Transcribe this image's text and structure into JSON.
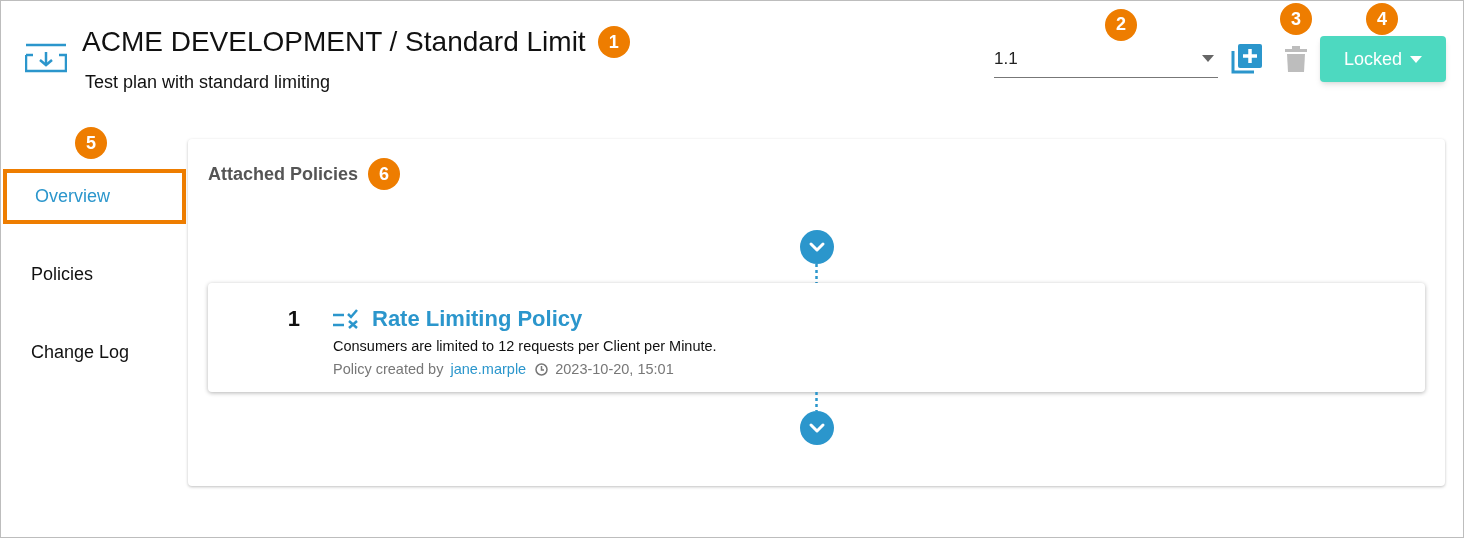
{
  "header": {
    "title": "ACME DEVELOPMENT / Standard Limit",
    "subtitle": "Test plan with standard limiting",
    "callout": "1"
  },
  "version_select": {
    "value": "1.1",
    "callout": "2"
  },
  "delete_button": {
    "disabled": true,
    "callout": "3"
  },
  "status_button": {
    "label": "Locked",
    "callout": "4"
  },
  "sidebar": {
    "callout": "5",
    "items": [
      {
        "label": "Overview",
        "selected": true,
        "highlighted": true
      },
      {
        "label": "Policies",
        "selected": false,
        "highlighted": false
      },
      {
        "label": "Change Log",
        "selected": false,
        "highlighted": false
      }
    ]
  },
  "attached_policies": {
    "title": "Attached Policies",
    "callout": "6",
    "policies": [
      {
        "number": "1",
        "name": "Rate Limiting Policy",
        "description": "Consumers are limited to 12 requests per Client per Minute.",
        "created_label": "Policy created by",
        "author": "jane.marple",
        "timestamp": "2023-10-20, 15:01"
      }
    ]
  }
}
